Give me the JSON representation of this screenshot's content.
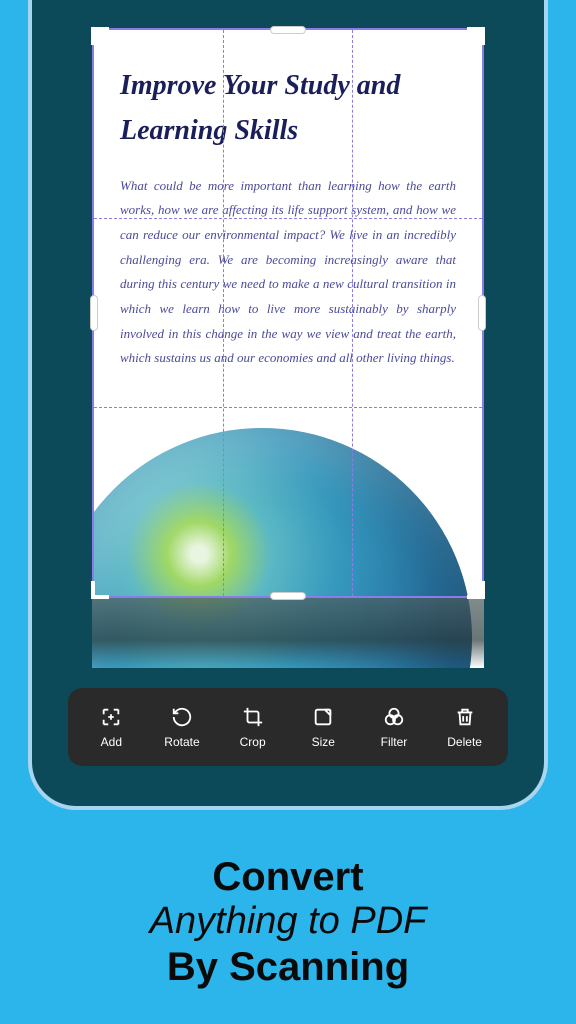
{
  "document": {
    "title": "Improve Your Study and Learning Skills",
    "body": "What could be more important than learning how the earth works, how we are affecting its life support system, and how we can reduce our environmental impact? We live in an incredibly challenging era. We are becoming increasingly aware that during this century we need to make a new cultural transition in which we learn how to live more sustainably by sharply involved in this change in the way we view and treat the earth, which sustains us and our economies and all other living things."
  },
  "toolbar": {
    "add": "Add",
    "rotate": "Rotate",
    "crop": "Crop",
    "size": "Size",
    "filter": "Filter",
    "delete": "Delete"
  },
  "marketing": {
    "line1": "Convert",
    "line2": "Anything to PDF",
    "line3": "By Scanning"
  }
}
